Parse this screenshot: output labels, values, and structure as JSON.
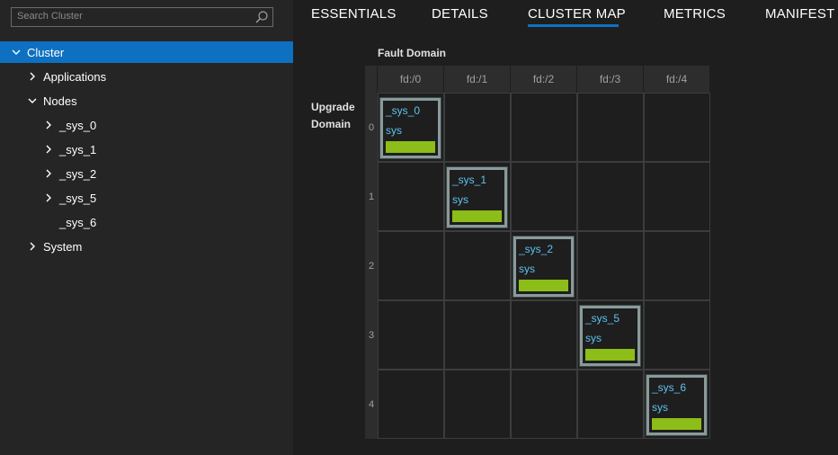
{
  "search": {
    "placeholder": "Search Cluster"
  },
  "tree": {
    "cluster": "Cluster",
    "applications": "Applications",
    "nodes": "Nodes",
    "node_items": [
      "_sys_0",
      "_sys_1",
      "_sys_2",
      "_sys_5",
      "_sys_6"
    ],
    "system": "System"
  },
  "tabs": [
    "ESSENTIALS",
    "DETAILS",
    "CLUSTER MAP",
    "METRICS",
    "MANIFEST"
  ],
  "active_tab": "CLUSTER MAP",
  "map": {
    "fault_domain_label": "Fault Domain",
    "upgrade_domain_label_line1": "Upgrade",
    "upgrade_domain_label_line2": "Domain",
    "fault_domains": [
      "fd:/0",
      "fd:/1",
      "fd:/2",
      "fd:/3",
      "fd:/4"
    ],
    "upgrade_domains": [
      "0",
      "1",
      "2",
      "3",
      "4"
    ],
    "nodes": [
      {
        "name": "_sys_0",
        "type": "sys",
        "health_color": "#8cbd18"
      },
      {
        "name": "_sys_1",
        "type": "sys",
        "health_color": "#8cbd18"
      },
      {
        "name": "_sys_2",
        "type": "sys",
        "health_color": "#8cbd18"
      },
      {
        "name": "_sys_5",
        "type": "sys",
        "health_color": "#8cbd18"
      },
      {
        "name": "_sys_6",
        "type": "sys",
        "health_color": "#8cbd18"
      }
    ]
  },
  "colors": {
    "accent": "#0e70c0",
    "healthy": "#8cbd18",
    "node_text": "#5fc3f0"
  }
}
